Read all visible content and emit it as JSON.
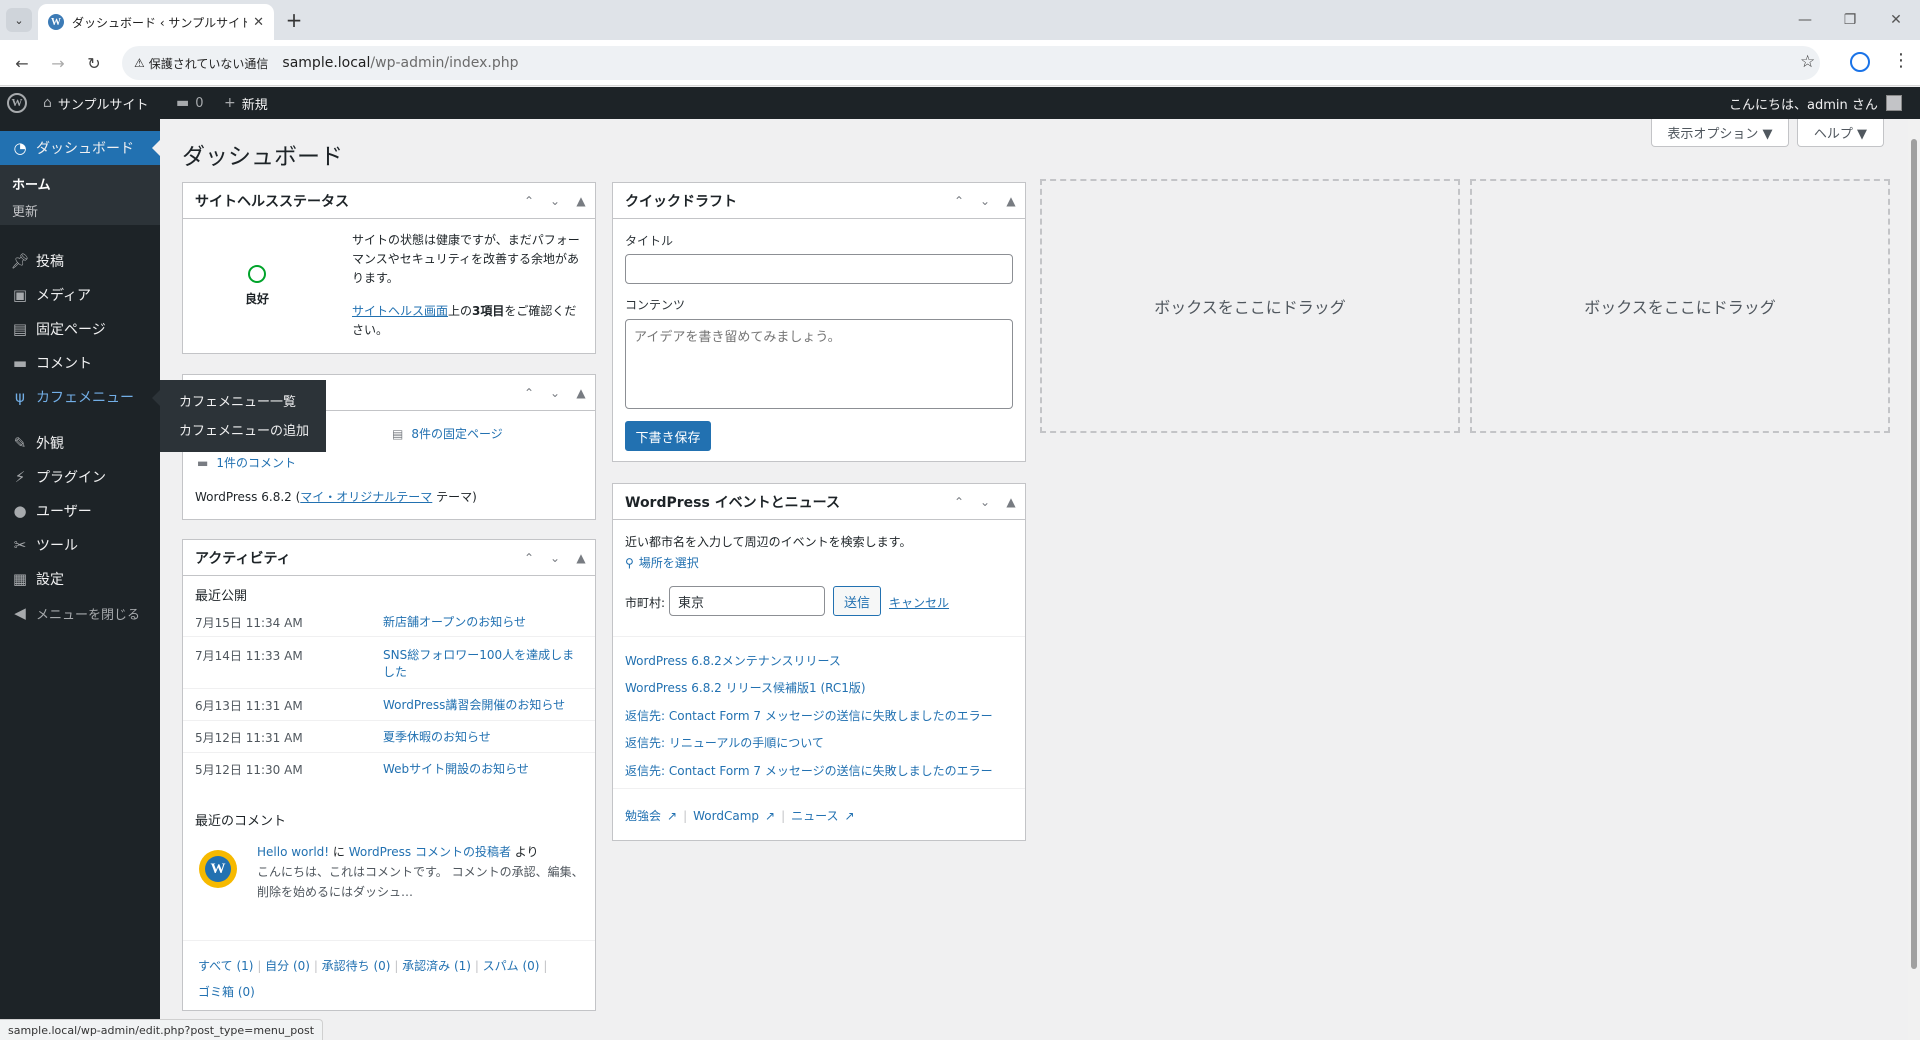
{
  "browser": {
    "tab_title": "ダッシュボード ‹ サンプルサイト — W",
    "security_label": "保護されていない通信",
    "url_host": "sample.local",
    "url_path": "/wp-admin/index.php",
    "status_url": "sample.local/wp-admin/edit.php?post_type=menu_post"
  },
  "adminbar": {
    "site_name": "サンプルサイト",
    "comments_count": "0",
    "new_label": "新規",
    "greeting": "こんにちは、admin さん"
  },
  "sidebar": {
    "dashboard": "ダッシュボード",
    "home": "ホーム",
    "updates": "更新",
    "posts": "投稿",
    "media": "メディア",
    "pages": "固定ページ",
    "comments": "コメント",
    "cafe_menu": "カフェメニュー",
    "appearance": "外観",
    "plugins": "プラグイン",
    "users": "ユーザー",
    "tools": "ツール",
    "settings": "設定",
    "collapse": "メニューを閉じる",
    "flyout": [
      "カフェメニュー一覧",
      "カフェメニューの追加"
    ]
  },
  "page": {
    "title": "ダッシュボード",
    "screen_options": "表示オプション ▼",
    "help": "ヘルプ ▼",
    "drop_here": "ボックスをここにドラッグ"
  },
  "site_health": {
    "title": "サイトヘルスステータス",
    "status": "良好",
    "text1": "サイトの状態は健康ですが、まだパフォーマンスやセキュリティを改善する余地があります。",
    "link": "サイトヘルス画面",
    "text2a": "上の",
    "text2b": "3項目",
    "text2c": "をご確認ください。"
  },
  "glance": {
    "pages": "8件の固定ページ",
    "comments": "1件のコメント",
    "version_prefix": "WordPress 6.8.2 (",
    "theme": "マイ・オリジナルテーマ",
    "version_suffix": " テーマ)"
  },
  "activity": {
    "title": "アクティビティ",
    "recent_published": "最近公開",
    "rows": [
      {
        "date": "7月15日 11:34 AM",
        "title": "新店舗オープンのお知らせ"
      },
      {
        "date": "7月14日 11:33 AM",
        "title": "SNS総フォロワー100人を達成しました"
      },
      {
        "date": "6月13日 11:31 AM",
        "title": "WordPress講習会開催のお知らせ"
      },
      {
        "date": "5月12日 11:31 AM",
        "title": "夏季休暇のお知らせ"
      },
      {
        "date": "5月12日 11:30 AM",
        "title": "Webサイト開設のお知らせ"
      }
    ],
    "recent_comments": "最近のコメント",
    "comment_post": "Hello world!",
    "comment_on": " に ",
    "comment_author": "WordPress コメントの投稿者",
    "comment_from": " より",
    "comment_excerpt": "こんにちは、これはコメントです。 コメントの承認、編集、削除を始めるにはダッシュ…",
    "filters": [
      "すべて (1)",
      "自分 (0)",
      "承認待ち (0)",
      "承認済み (1)",
      "スパム (0)",
      "ゴミ箱 (0)"
    ]
  },
  "quick_draft": {
    "title": "クイックドラフト",
    "title_label": "タイトル",
    "content_label": "コンテンツ",
    "content_placeholder": "アイデアを書き留めてみましょう。",
    "save": "下書き保存"
  },
  "events": {
    "title": "WordPress イベントとニュース",
    "intro": "近い都市名を入力して周辺のイベントを検索します。",
    "select_location": "場所を選択",
    "city_label": "市町村:",
    "city_value": "東京",
    "submit": "送信",
    "cancel": "キャンセル",
    "news": [
      "WordPress 6.8.2メンテナンスリリース",
      "WordPress 6.8.2 リリース候補版1 (RC1版)",
      "返信先: Contact Form 7 メッセージの送信に失敗しましたのエラー",
      "返信先: リニューアルの手順について",
      "返信先: Contact Form 7 メッセージの送信に失敗しましたのエラー"
    ],
    "footer_links": [
      "勉強会",
      "WordCamp",
      "ニュース"
    ]
  }
}
